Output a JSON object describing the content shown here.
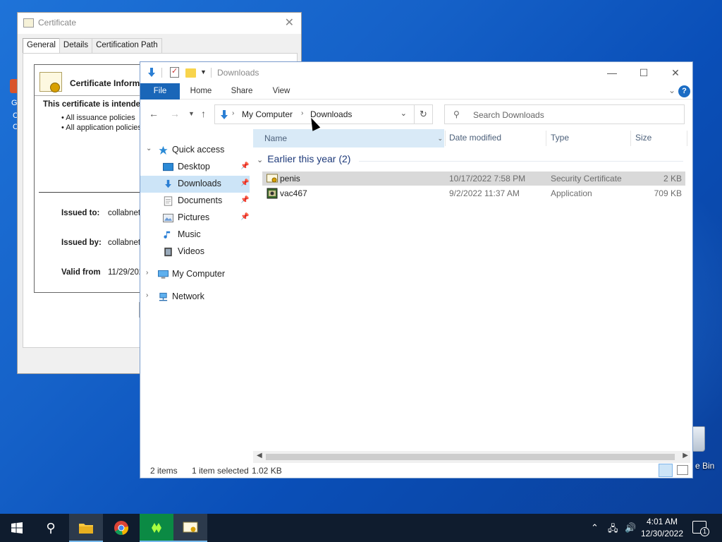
{
  "desktop": {
    "recycle_label": "e Bin",
    "left_partial": [
      "G",
      "C",
      "C"
    ]
  },
  "cert_dialog": {
    "title": "Certificate",
    "tabs": [
      "General",
      "Details",
      "Certification Path"
    ],
    "heading": "Certificate Inform",
    "intended": "This certificate is intende",
    "bullets": [
      "• All issuance policies",
      "• All application policies"
    ],
    "issued_to_label": "Issued to:",
    "issued_to_value": "collabnet.",
    "issued_by_label": "Issued by:",
    "issued_by_value": "collabnet.",
    "valid_from_label": "Valid from",
    "valid_from_value": "11/29/202"
  },
  "explorer": {
    "title": "Downloads",
    "ribbon": {
      "file": "File",
      "home": "Home",
      "share": "Share",
      "view": "View",
      "help": "?"
    },
    "breadcrumb": [
      "My Computer",
      "Downloads"
    ],
    "search_placeholder": "Search Downloads",
    "sidebar": [
      {
        "label": "Quick access",
        "icon": "star-icon",
        "pinned": false
      },
      {
        "label": "Desktop",
        "icon": "desktop-icon",
        "pinned": true
      },
      {
        "label": "Downloads",
        "icon": "download-icon",
        "pinned": true,
        "selected": true
      },
      {
        "label": "Documents",
        "icon": "documents-icon",
        "pinned": true
      },
      {
        "label": "Pictures",
        "icon": "pictures-icon",
        "pinned": true
      },
      {
        "label": "Music",
        "icon": "music-icon",
        "pinned": false
      },
      {
        "label": "Videos",
        "icon": "videos-icon",
        "pinned": false
      },
      {
        "label": "My Computer",
        "icon": "computer-icon",
        "pinned": false
      },
      {
        "label": "Network",
        "icon": "network-icon",
        "pinned": false
      }
    ],
    "columns": {
      "name": "Name",
      "date": "Date modified",
      "type": "Type",
      "size": "Size"
    },
    "group": "Earlier this year (2)",
    "files": [
      {
        "name": "penis",
        "date": "10/17/2022 7:58 PM",
        "type": "Security Certificate",
        "size": "2 KB",
        "selected": true,
        "icon": "certificate-file-icon"
      },
      {
        "name": "vac467",
        "date": "9/2/2022 11:37 AM",
        "type": "Application",
        "size": "709 KB",
        "selected": false,
        "icon": "application-file-icon"
      }
    ],
    "status": {
      "count": "2 items",
      "selected": "1 item selected",
      "size": "1.02 KB"
    }
  },
  "taskbar": {
    "time": "4:01 AM",
    "date": "12/30/2022",
    "notifications": "1"
  },
  "colors": {
    "accent": "#1a66b8",
    "selection": "#cce4f7",
    "taskbar": "#0f1c2e"
  }
}
